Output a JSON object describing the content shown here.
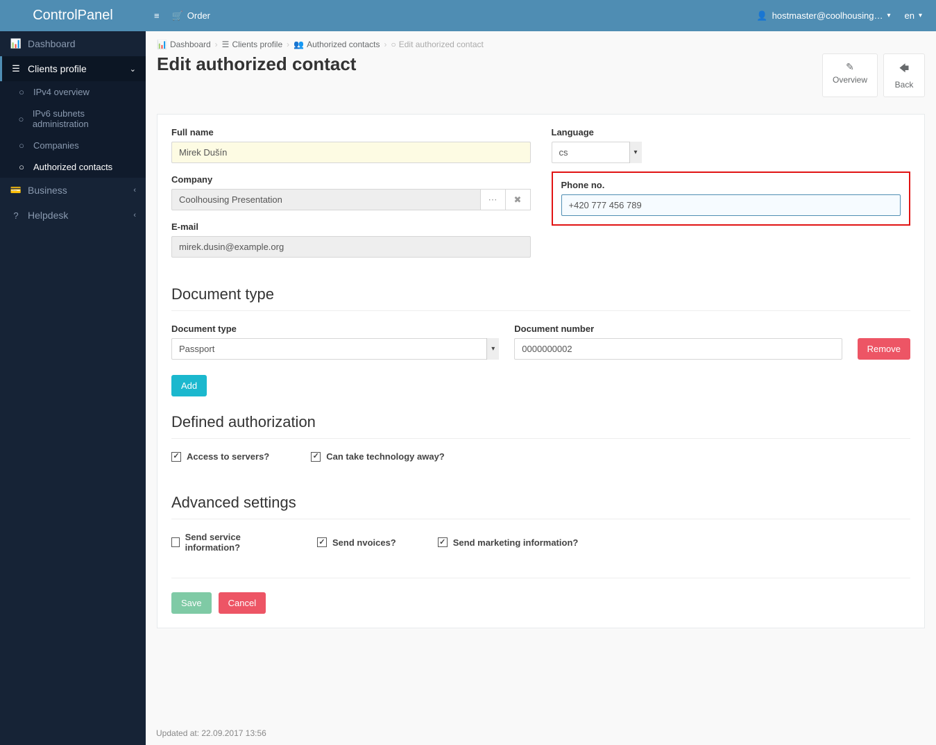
{
  "brand": "ControlPanel",
  "topnav": {
    "order": "Order",
    "user": "hostmaster@coolhousing…",
    "lang": "en"
  },
  "sidebar": {
    "dashboard": "Dashboard",
    "clients_profile": "Clients profile",
    "ipv4": "IPv4 overview",
    "ipv6": "IPv6 subnets administration",
    "companies": "Companies",
    "authorized": "Authorized contacts",
    "business": "Business",
    "helpdesk": "Helpdesk"
  },
  "breadcrumb": {
    "dashboard": "Dashboard",
    "clients_profile": "Clients profile",
    "authorized": "Authorized contacts",
    "current": "Edit authorized contact"
  },
  "page": {
    "title": "Edit authorized contact",
    "overview": "Overview",
    "back": "Back"
  },
  "form": {
    "full_name_label": "Full name",
    "full_name": "Mirek Dušín",
    "company_label": "Company",
    "company": "Coolhousing Presentation",
    "email_label": "E-mail",
    "email": "mirek.dusin@example.org",
    "language_label": "Language",
    "language": "cs",
    "phone_label": "Phone no.",
    "phone": "+420 777 456 789"
  },
  "doc": {
    "section": "Document type",
    "type_label": "Document type",
    "type_value": "Passport",
    "number_label": "Document number",
    "number_value": "0000000002",
    "remove": "Remove",
    "add": "Add"
  },
  "auth": {
    "section": "Defined authorization",
    "servers": "Access to servers?",
    "tech": "Can take technology away?"
  },
  "adv": {
    "section": "Advanced settings",
    "service": "Send service information?",
    "invoices": "Send nvoices?",
    "marketing": "Send marketing information?"
  },
  "buttons": {
    "save": "Save",
    "cancel": "Cancel"
  },
  "updated": "Updated at: 22.09.2017 13:56"
}
